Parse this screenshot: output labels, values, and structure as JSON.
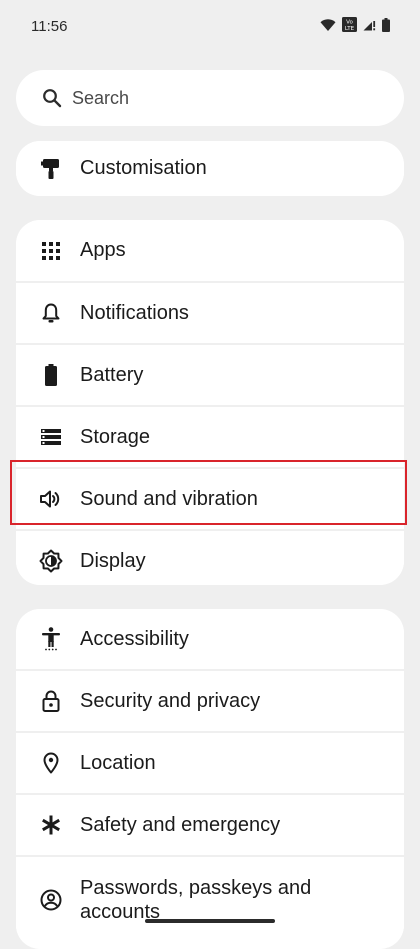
{
  "status_bar": {
    "time": "11:56",
    "volte_badge_top": "Vo",
    "volte_badge_bottom": "LTE"
  },
  "search": {
    "placeholder": "Search",
    "icon": "search-icon"
  },
  "groups": [
    {
      "items": [
        {
          "label": "Customisation",
          "icon": "paint-roller-icon"
        }
      ]
    },
    {
      "items": [
        {
          "label": "Apps",
          "icon": "apps-grid-icon"
        },
        {
          "label": "Notifications",
          "icon": "bell-icon"
        },
        {
          "label": "Battery",
          "icon": "battery-icon"
        },
        {
          "label": "Storage",
          "icon": "storage-icon"
        },
        {
          "label": "Sound and vibration",
          "icon": "speaker-icon",
          "highlighted": true
        },
        {
          "label": "Display",
          "icon": "display-brightness-icon"
        }
      ]
    },
    {
      "items": [
        {
          "label": "Accessibility",
          "icon": "accessibility-icon"
        },
        {
          "label": "Security and privacy",
          "icon": "lock-icon"
        },
        {
          "label": "Location",
          "icon": "location-pin-icon"
        },
        {
          "label": "Safety and emergency",
          "icon": "asterisk-icon"
        },
        {
          "label": "Passwords, passkeys and accounts",
          "icon": "account-circle-icon"
        }
      ]
    }
  ],
  "colors": {
    "background": "#efefef",
    "card": "#ffffff",
    "highlight_border": "#d9242b",
    "text": "#1b1b1b"
  }
}
